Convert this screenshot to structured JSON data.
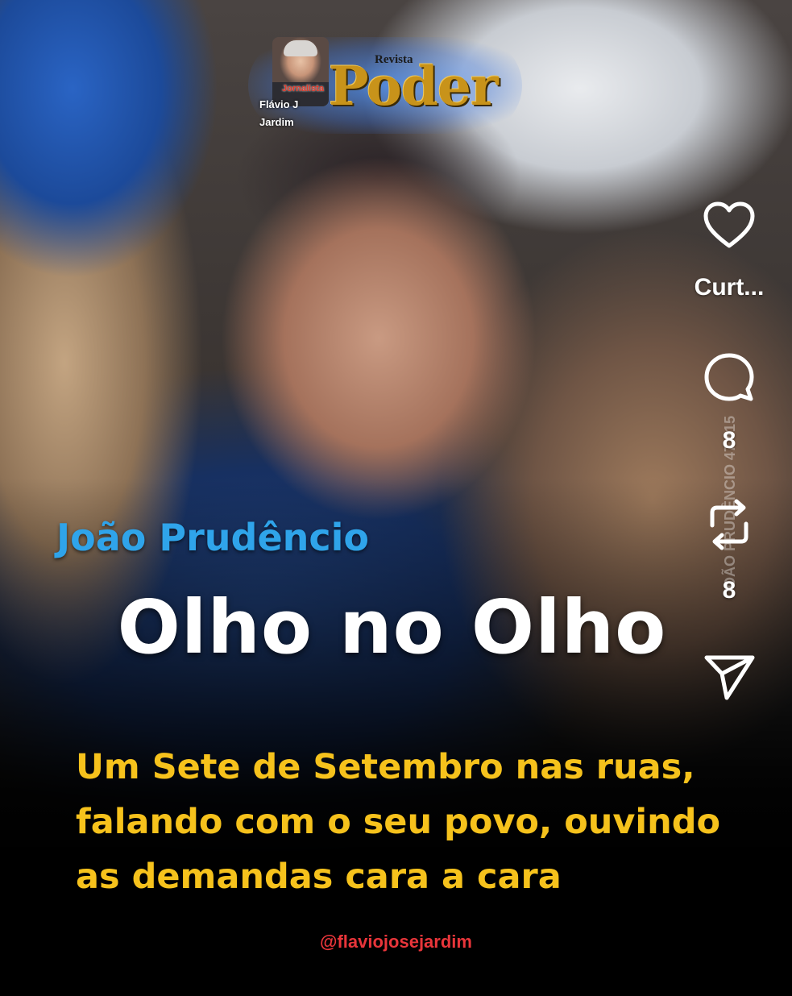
{
  "logo": {
    "tag": "Jornalista",
    "person_line1": "Flávio J",
    "person_line2": "Jardim",
    "revista": "Revista",
    "brand": "Poder"
  },
  "rail": {
    "like_label": "Curt...",
    "comments_count": "8",
    "reposts_count": "8",
    "watermark": "JOÃO PRUDÊNCIO 47.415"
  },
  "post": {
    "subject": "João Prudêncio",
    "headline": "Olho no Olho",
    "body": "Um Sete de Setembro nas ruas, falando com o seu povo, ouvindo as demandas cara a cara",
    "handle": "@flaviojosejardim"
  },
  "colors": {
    "subject": "#2fa4ea",
    "headline": "#ffffff",
    "body": "#f6c21c",
    "handle": "#e8353a",
    "brand": "#c8931a"
  },
  "icons": [
    "heart-icon",
    "comment-icon",
    "repost-icon",
    "send-icon"
  ]
}
